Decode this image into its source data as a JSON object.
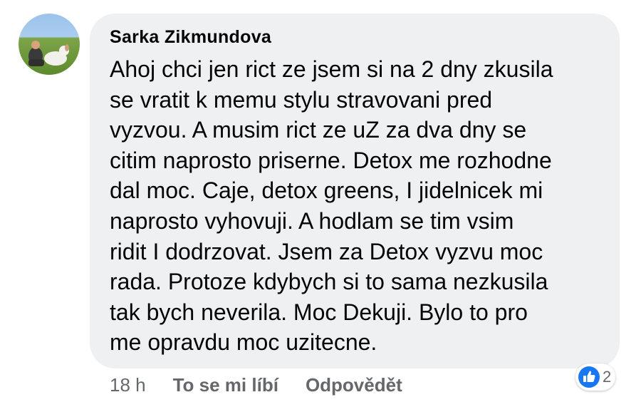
{
  "comment": {
    "author": "Sarka Zikmundova",
    "lines": [
      "Ahoj chci jen rict ze jsem si na 2 dny zkusila",
      "se vratit k memu stylu stravovani pred",
      "vyzvou. A musim rict ze uZ za dva dny se",
      "citim naprosto priserne. Detox me rozhodne",
      "dal moc. Caje, detox greens, I jidelnicek mi",
      "naprosto vyhovuji. A hodlam se tim vsim",
      "ridit I dodrzovat. Jsem za Detox vyzvu moc",
      "rada. Protoze kdybych si to sama nezkusila",
      "tak bych neverila. Moc Dekuji. Bylo to pro",
      "me opravdu moc uzitecne."
    ]
  },
  "actions": {
    "time": "18 h",
    "like_label": "To se mi líbí",
    "reply_label": "Odpovědět"
  },
  "reactions": {
    "icon": "like-icon",
    "count": "2",
    "color": "#1877f2"
  }
}
